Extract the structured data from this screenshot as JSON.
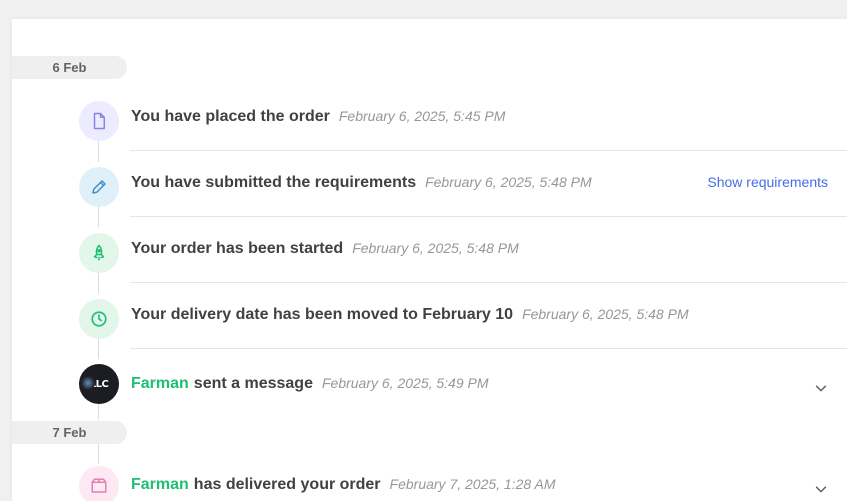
{
  "sections": [
    {
      "date": "6 Feb"
    },
    {
      "date": "7 Feb"
    }
  ],
  "events": [
    {
      "title": "You have placed the order",
      "time": "February 6, 2025, 5:45 PM",
      "icon": "document-icon"
    },
    {
      "title": "You have submitted the requirements",
      "time": "February 6, 2025, 5:48 PM",
      "icon": "pencil-icon",
      "action": "Show requirements"
    },
    {
      "title": "Your order has been started",
      "time": "February 6, 2025, 5:48 PM",
      "icon": "rocket-icon"
    },
    {
      "title": "Your delivery date has been moved to February 10",
      "time": "February 6, 2025, 5:48 PM",
      "icon": "clock-icon"
    },
    {
      "name": "Farman",
      "title": "sent a message",
      "time": "February 6, 2025, 5:49 PM",
      "icon": "avatar",
      "avatar_text": "LLC"
    },
    {
      "name": "Farman",
      "title": "has delivered your order",
      "time": "February 7, 2025, 1:28 AM",
      "icon": "package-icon"
    }
  ],
  "colors": {
    "accent_green": "#1dbf73",
    "link_blue": "#446ee7",
    "icon_purple": "#8a84e0",
    "icon_blue": "#3f8fc9",
    "icon_green": "#1dbf73",
    "icon_pink": "#e37fb8"
  }
}
